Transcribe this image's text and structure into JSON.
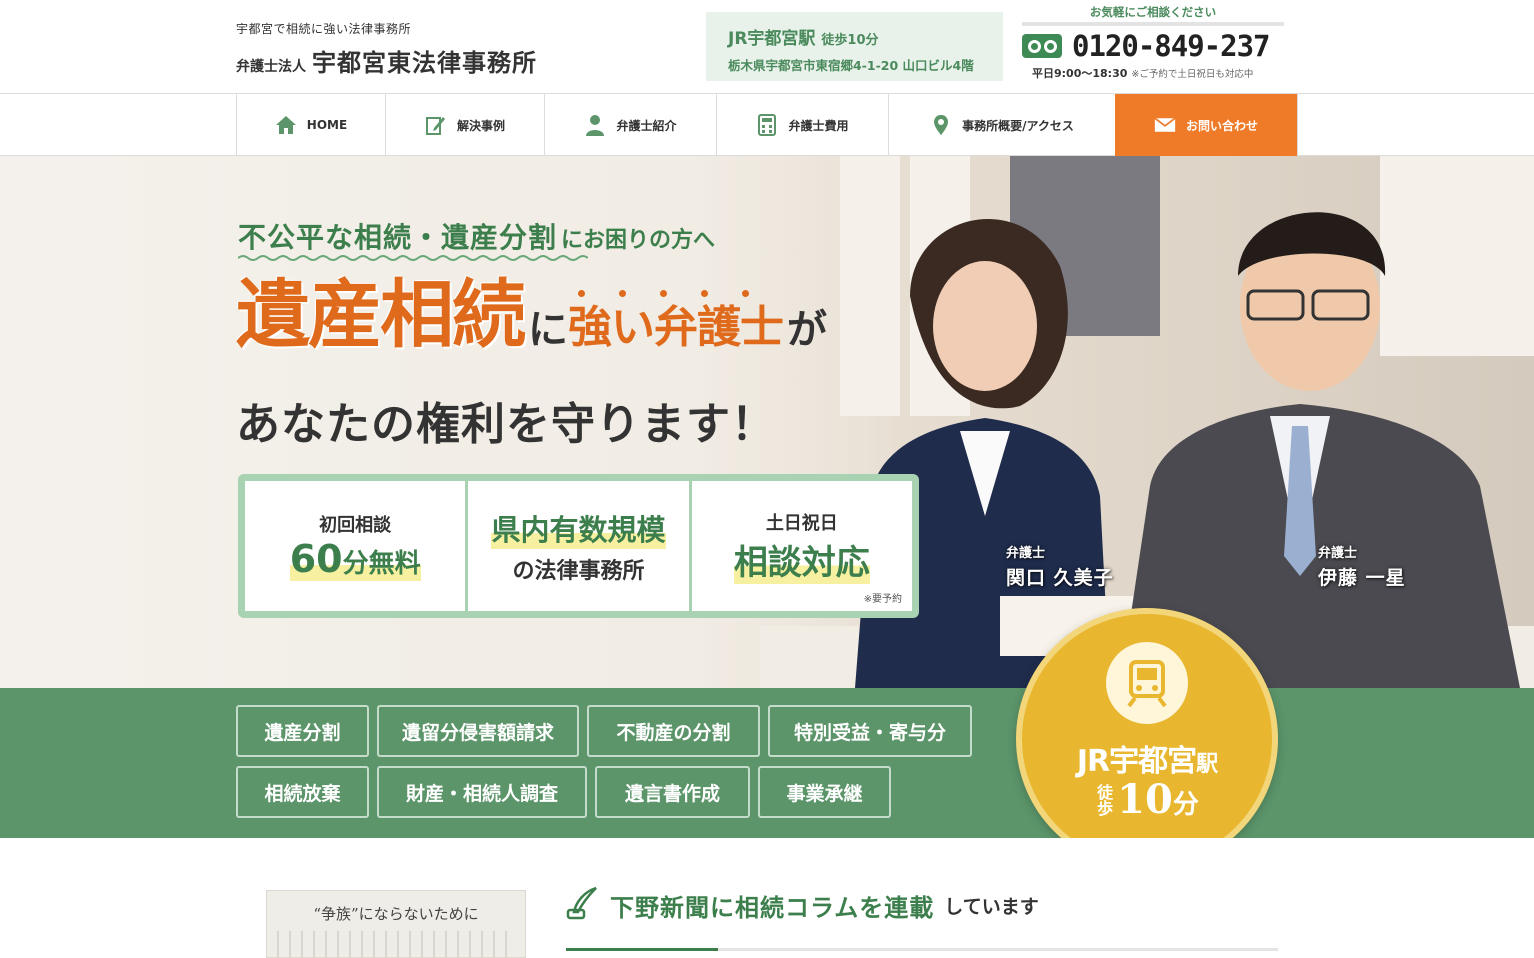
{
  "header": {
    "tagline": "宇都宮で相続に強い法律事務所",
    "firm_prefix": "弁護士法人",
    "firm_name": "宇都宮東法律事務所",
    "access": {
      "station": "JR宇都宮駅",
      "walk": "徒歩10分",
      "address": "栃木県宇都宮市東宿郷4-1-20 山口ビル4階"
    },
    "phone": {
      "heading": "お気軽にご相談ください",
      "number": "0120-849-237",
      "hours": "平日9:00〜18:30",
      "note": "※ご予約で土日祝日も対応中"
    }
  },
  "nav": {
    "items": [
      {
        "label": "HOME",
        "icon": "home-icon"
      },
      {
        "label": "解決事例",
        "icon": "edit-note-icon"
      },
      {
        "label": "弁護士紹介",
        "icon": "person-icon"
      },
      {
        "label": "弁護士費用",
        "icon": "calculator-icon"
      },
      {
        "label": "事務所概要/アクセス",
        "icon": "map-pin-icon"
      },
      {
        "label": "お問い合わせ",
        "icon": "mail-icon"
      }
    ]
  },
  "hero": {
    "lead_strong": "不公平な相続・遺産分割",
    "lead_weak": "にお困りの方へ",
    "title_big": "遺産相続",
    "title_ni": "に",
    "title_strong": "強い弁護士",
    "title_ga": "が",
    "subtitle": "あなたの権利を守ります！",
    "features": [
      {
        "line1": "初回相談",
        "num": "60",
        "unit": "分無料"
      },
      {
        "line1": "県内有数規模",
        "line2": "の法律事務所"
      },
      {
        "line1": "土日祝日",
        "line2": "相談対応",
        "note": "※要予約"
      }
    ],
    "lawyers": [
      {
        "role": "弁護士",
        "name": "関口 久美子"
      },
      {
        "role": "弁護士",
        "name": "伊藤 一星"
      }
    ]
  },
  "categories": {
    "row1": [
      "遺産分割",
      "遺留分侵害額請求",
      "不動産の分割",
      "特別受益・寄与分"
    ],
    "row2": [
      "相続放棄",
      "財産・相続人調査",
      "遺言書作成",
      "事業承継"
    ]
  },
  "badge": {
    "station": "JR宇都宮",
    "eki": "駅",
    "walk_vertical": "徒歩",
    "minutes": "10",
    "minutes_unit": "分",
    "icon": "train-icon"
  },
  "news": {
    "image_caption": "“争族”にならないために",
    "heading_strong": "下野新聞に相続コラムを連載",
    "heading_weak": "しています",
    "icon": "quill-pen-icon"
  },
  "colors": {
    "brand_green": "#3c7f4c",
    "band_green": "#5c956a",
    "accent_orange": "#e06a1c",
    "contact_orange": "#ef7a28",
    "badge_gold": "#e8b72f"
  }
}
